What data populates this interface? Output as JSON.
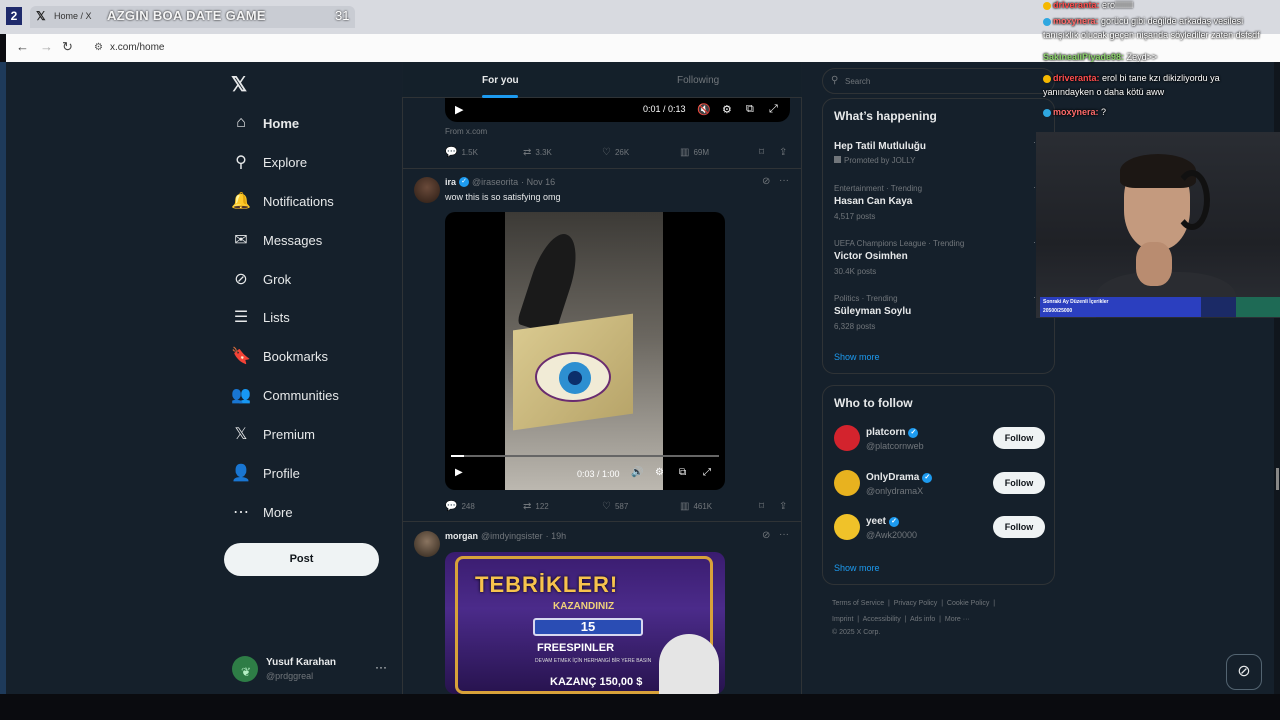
{
  "stream": {
    "badge": "2",
    "game_title": "AZGIN BOA DATE GAME",
    "game_number": "31"
  },
  "browser": {
    "tab_title": "Home / X",
    "url": "x.com/home"
  },
  "sidebar": {
    "items": [
      {
        "label": "Home",
        "icon": "home-icon",
        "glyph": "⌂",
        "active": true
      },
      {
        "label": "Explore",
        "icon": "search-icon",
        "glyph": "⚲"
      },
      {
        "label": "Notifications",
        "icon": "bell-icon",
        "glyph": "🔔"
      },
      {
        "label": "Messages",
        "icon": "envelope-icon",
        "glyph": "✉"
      },
      {
        "label": "Grok",
        "icon": "grok-icon",
        "glyph": "⊘"
      },
      {
        "label": "Lists",
        "icon": "list-icon",
        "glyph": "☰"
      },
      {
        "label": "Bookmarks",
        "icon": "bookmark-icon",
        "glyph": "🔖"
      },
      {
        "label": "Communities",
        "icon": "people-icon",
        "glyph": "👥"
      },
      {
        "label": "Premium",
        "icon": "x-icon",
        "glyph": "𝕏"
      },
      {
        "label": "Profile",
        "icon": "person-icon",
        "glyph": "👤"
      },
      {
        "label": "More",
        "icon": "more-circle-icon",
        "glyph": "⋯"
      }
    ],
    "post_label": "Post",
    "account": {
      "name": "Yusuf Karahan",
      "handle": "@prdggreal"
    }
  },
  "timeline": {
    "tabs": {
      "for_you": "For you",
      "following": "Following"
    },
    "top_video": {
      "time": "0:01 / 0:13",
      "from": "From x.com"
    },
    "tweet0_stats": {
      "replies": "1.5K",
      "reposts": "3.3K",
      "likes": "26K",
      "views": "69M"
    },
    "tweet1": {
      "name": "ira",
      "handle": "@iraseorita",
      "date": "· Nov 16",
      "text": "wow this is so satisfying omg",
      "video_time": "0:03 / 1:00",
      "video_progress": 0.05,
      "stats": {
        "replies": "248",
        "reposts": "122",
        "likes": "587",
        "views": "461K"
      }
    },
    "tweet2": {
      "name": "morgan",
      "handle": "@imdyingsister",
      "date": "· 19h",
      "image": {
        "title": "TEBRİKLER!",
        "subtitle": "KAZANDINIZ",
        "number": "15",
        "free": "FREESPINLER",
        "small": "DEVAM ETMEK İÇİN HERHANGİ BİR YERE BASIN",
        "win": "KAZANÇ 150,00 $"
      }
    }
  },
  "right": {
    "search_placeholder": "Search",
    "happening": {
      "title": "What’s happening",
      "trends": [
        {
          "meta": "Promoted by JOLLY",
          "name": "Hep Tatil Mutluluğu",
          "posts": ""
        },
        {
          "meta": "Entertainment · Trending",
          "name": "Hasan Can Kaya",
          "posts": "4,517 posts"
        },
        {
          "meta": "UEFA Champions League · Trending",
          "name": "Victor Osimhen",
          "posts": "30.4K posts"
        },
        {
          "meta": "Politics · Trending",
          "name": "Süleyman Soylu",
          "posts": "6,328 posts"
        }
      ],
      "show_more": "Show more"
    },
    "who_to_follow": {
      "title": "Who to follow",
      "users": [
        {
          "name": "platcorn",
          "handle": "@platcornweb",
          "color": "#d3232d"
        },
        {
          "name": "OnlyDrama",
          "handle": "@onlydramaX",
          "color": "#e8b21f"
        },
        {
          "name": "yeet",
          "handle": "@Awk20000",
          "color": "#f0c229"
        }
      ],
      "follow_label": "Follow",
      "show_more": "Show more"
    },
    "footer": {
      "line1": [
        "Terms of Service",
        "Privacy Policy",
        "Cookie Policy"
      ],
      "line2": [
        "Imprint",
        "Accessibility",
        "Ads info",
        "More ···"
      ],
      "copyright": "© 2025 X Corp."
    }
  },
  "chat": [
    {
      "user": "driveranta:",
      "msg": "erolllllllll",
      "badge": "gold"
    },
    {
      "user": "moxynera:",
      "msg": "gorücü gibi değilde arkadaş vesilesi",
      "badge": "blue"
    },
    {
      "user": "",
      "msg": "tanışıklık olucak geçen nişanda söylediler zaten dsfsdf",
      "badge": ""
    },
    {
      "user": "SakinealiPiyade98:",
      "msg": "Zeyd>>",
      "badge": ""
    },
    {
      "user": "driveranta:",
      "msg": "erol bi tane kzı dikizliyordu ya",
      "badge": "gold"
    },
    {
      "user": "",
      "msg": "yanındayken o daha kötü aww",
      "badge": ""
    },
    {
      "user": "moxynera:",
      "msg": "?",
      "badge": "blue"
    }
  ],
  "goal": {
    "label": "Sonraki Ay Düzenli İçerikler",
    "value": "20500/25000",
    "fraction": 0.82
  }
}
